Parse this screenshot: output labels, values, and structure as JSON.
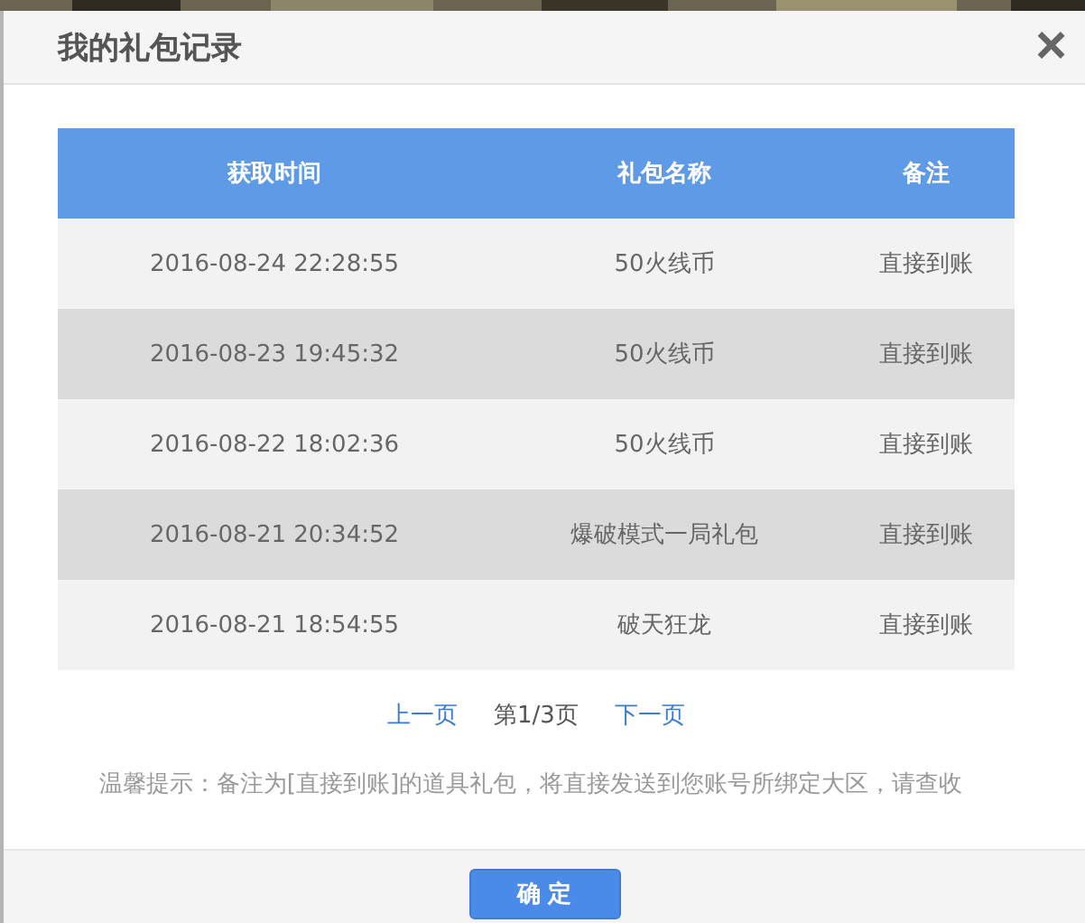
{
  "dialog": {
    "title": "我的礼包记录",
    "close": "×"
  },
  "table": {
    "columns": [
      "获取时间",
      "礼包名称",
      "备注"
    ],
    "rows": [
      [
        "2016-08-24 22:28:55",
        "50火线币",
        "直接到账"
      ],
      [
        "2016-08-23 19:45:32",
        "50火线币",
        "直接到账"
      ],
      [
        "2016-08-22 18:02:36",
        "50火线币",
        "直接到账"
      ],
      [
        "2016-08-21 20:34:52",
        "爆破模式一局礼包",
        "直接到账"
      ],
      [
        "2016-08-21 18:54:55",
        "破天狂龙",
        "直接到账"
      ]
    ]
  },
  "pagination": {
    "prev": "上一页",
    "page": "第1/3页",
    "next": "下一页"
  },
  "tip": "温馨提示：备注为[直接到账]的道具礼包，将直接发送到您账号所绑定大区，请查收",
  "confirm": "确 定"
}
